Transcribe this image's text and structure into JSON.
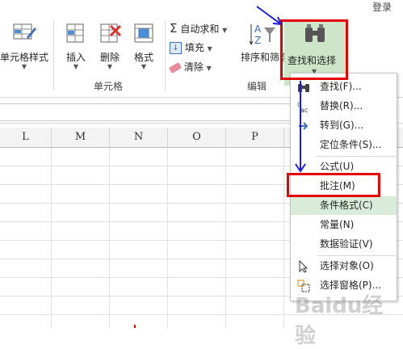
{
  "topbar": {
    "login": "登录"
  },
  "ribbon": {
    "cell_style": "单元格样式",
    "insert": "插入",
    "delete": "删除",
    "format": "格式",
    "cells_group": "单元格",
    "autosum": "自动求和",
    "fill": "填充",
    "clear": "清除",
    "sort_filter": "排序和筛选",
    "find_select": "查找和选择",
    "edit_group": "编辑"
  },
  "columns": [
    "L",
    "M",
    "N",
    "O",
    "P"
  ],
  "menu": {
    "items": [
      {
        "label": "查找(F)...",
        "icon": "binoculars-icon"
      },
      {
        "label": "替换(R)...",
        "icon": "replace-icon"
      },
      {
        "label": "转到(G)...",
        "icon": "arrow-right-icon"
      },
      {
        "label": "定位条件(S)...",
        "icon": ""
      },
      {
        "label": "公式(U)",
        "icon": ""
      },
      {
        "label": "批注(M)",
        "icon": ""
      },
      {
        "label": "条件格式(C)",
        "icon": ""
      },
      {
        "label": "常量(N)",
        "icon": ""
      },
      {
        "label": "数据验证(V)",
        "icon": ""
      },
      {
        "label": "选择对象(O)",
        "icon": "cursor-icon"
      },
      {
        "label": "选择窗格(P)...",
        "icon": "selection-pane-icon"
      }
    ]
  },
  "watermark": "Baidu经验",
  "colors": {
    "highlight": "#d9ebd9",
    "annotation_red": "#e30000",
    "annotation_blue": "#1a1ae6"
  }
}
